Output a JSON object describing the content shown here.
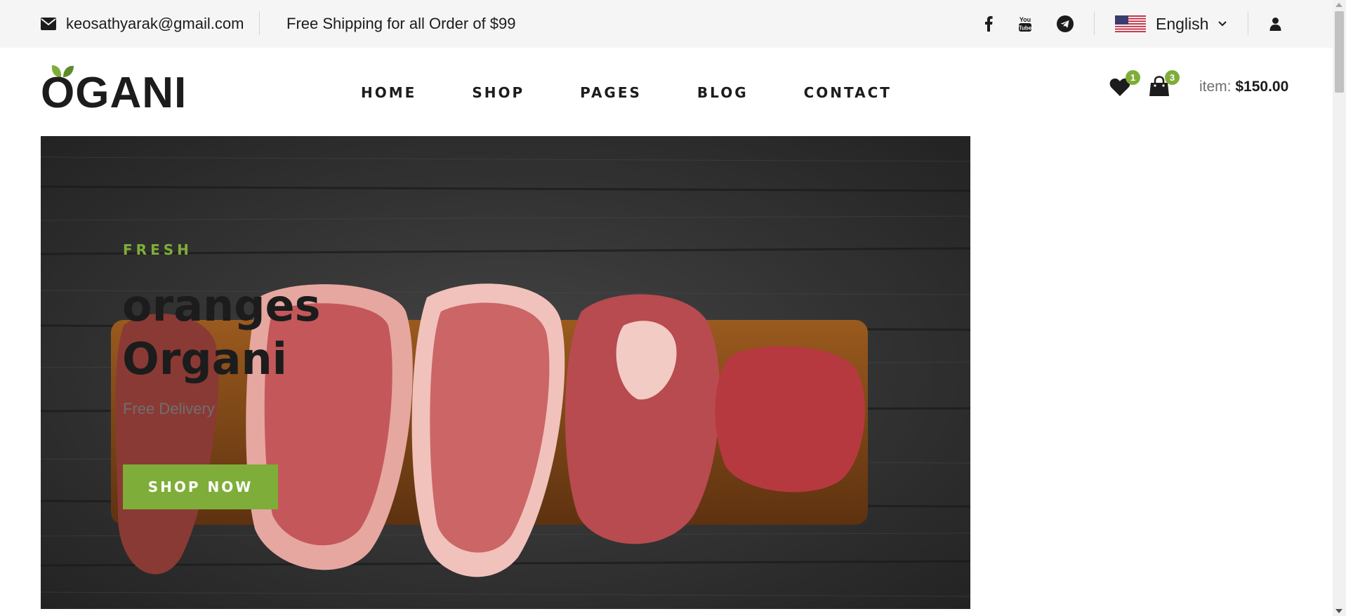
{
  "topbar": {
    "email": "keosathyarak@gmail.com",
    "shipping": "Free Shipping for all Order of $99",
    "social_icons": [
      "facebook-icon",
      "youtube-icon",
      "telegram-icon"
    ],
    "language": "English",
    "language_flag": "us-flag-icon",
    "user_icon": "user-icon"
  },
  "header": {
    "logo": "OGANI",
    "nav": [
      "HOME",
      "SHOP",
      "PAGES",
      "BLOG",
      "CONTACT"
    ],
    "wishlist_count": "1",
    "cart_count": "3",
    "item_label": "item:",
    "item_price": "$150.00"
  },
  "hero": {
    "subtitle": "FRESH",
    "title_line1": "oranges",
    "title_line2": "Organi",
    "text": "Free Delivery",
    "button": "SHOP NOW"
  },
  "colors": {
    "accent": "#7fad39",
    "dark": "#1c1c1c",
    "topbar_bg": "#f5f5f5"
  }
}
